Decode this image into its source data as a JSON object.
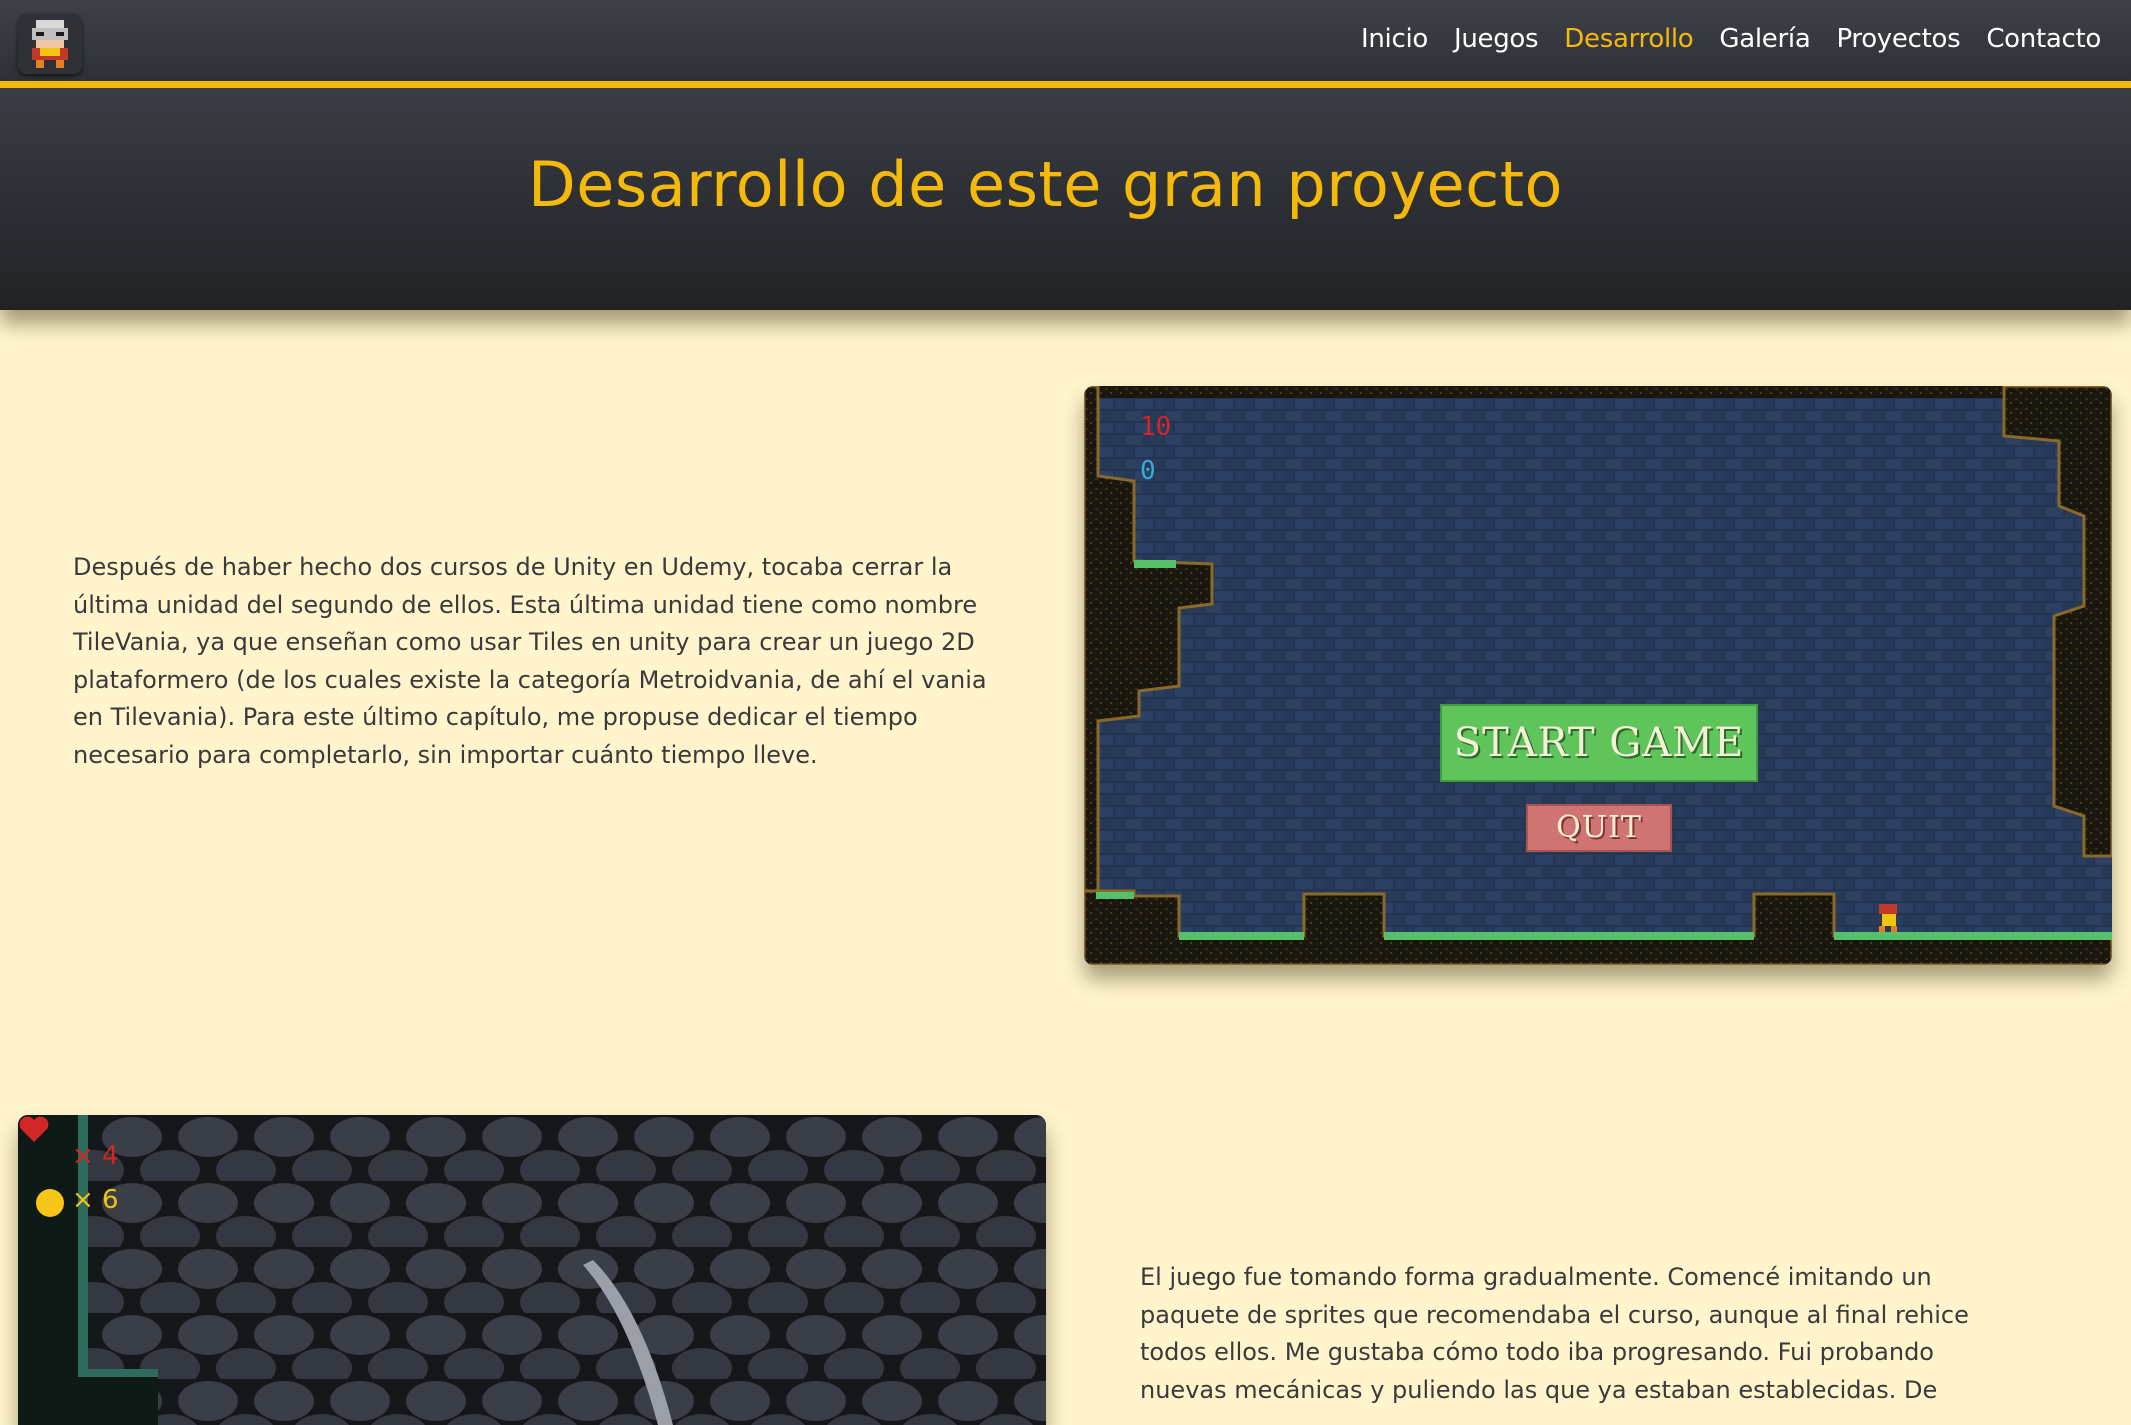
{
  "nav": {
    "items": [
      {
        "label": "Inicio"
      },
      {
        "label": "Juegos"
      },
      {
        "label": "Desarrollo"
      },
      {
        "label": "Galería"
      },
      {
        "label": "Proyectos"
      },
      {
        "label": "Contacto"
      }
    ],
    "active": "Desarrollo"
  },
  "hero": {
    "title": "Desarrollo de este gran proyecto"
  },
  "sections": [
    {
      "text": "Después de haber hecho dos cursos de Unity en Udemy, tocaba cerrar la última unidad del segundo de ellos. Esta última unidad tiene como nombre TileVania, ya que enseñan como usar Tiles en unity para crear un juego 2D plataformero (de los cuales existe la categoría Metroidvania, de ahí el vania en Tilevania). Para este último capítulo, me propuse dedicar el tiempo necesario para completarlo, sin importar cuánto tiempo lleve.",
      "screenshot": {
        "score_red": "10",
        "score_blue": "0",
        "start_button": "START GAME",
        "quit_button": "QUIT"
      }
    },
    {
      "text": "El juego fue tomando forma gradualmente. Comencé imitando un paquete de sprites que recomendaba el curso, aunque al final rehice todos ellos. Me gustaba cómo todo iba progresando. Fui probando nuevas mecánicas y puliendo las que ya estaban establecidas. De",
      "screenshot": {
        "lives": "× 4",
        "coins": "× 6"
      }
    }
  ],
  "colors": {
    "accent": "#f5b90b",
    "background": "#fff4cc",
    "header": "#2e3036"
  }
}
